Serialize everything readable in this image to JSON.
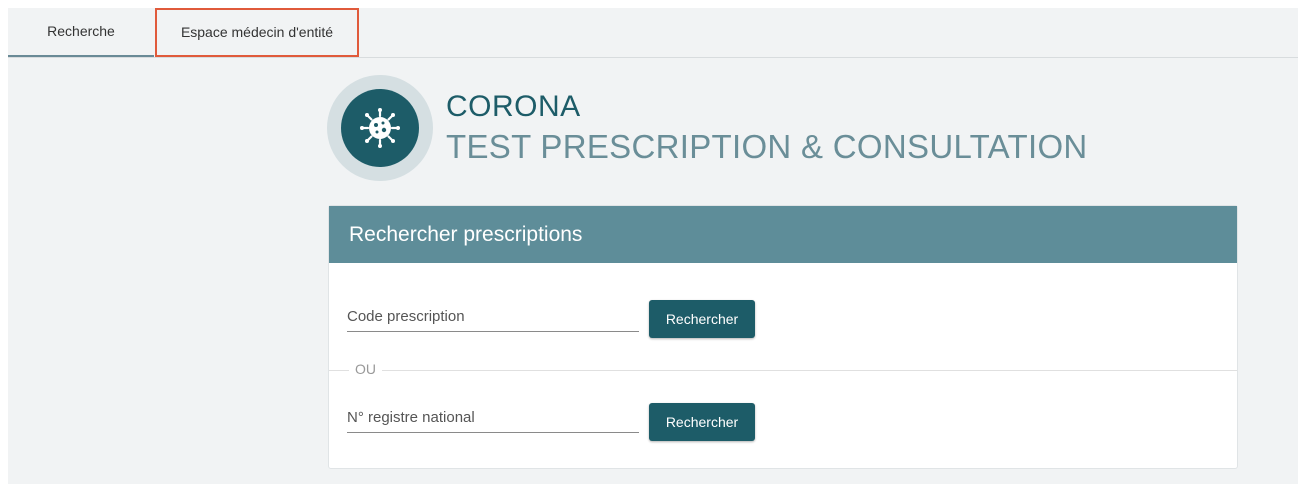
{
  "tabs": [
    {
      "label": "Recherche",
      "active": true
    },
    {
      "label": "Espace médecin d'entité",
      "highlighted": true
    }
  ],
  "header": {
    "title_line1": "CORONA",
    "title_line2": "TEST PRESCRIPTION & CONSULTATION",
    "logo_icon": "virus-icon"
  },
  "card": {
    "title": "Rechercher prescriptions",
    "prescription_field": {
      "placeholder": "Code prescription",
      "value": ""
    },
    "prescription_button": "Rechercher",
    "separator": "OU",
    "national_field": {
      "placeholder": "N° registre national",
      "value": ""
    },
    "national_button": "Rechercher"
  },
  "colors": {
    "primary": "#1d5c68",
    "header_bg": "#5e8d99",
    "highlight": "#e05a3b"
  }
}
